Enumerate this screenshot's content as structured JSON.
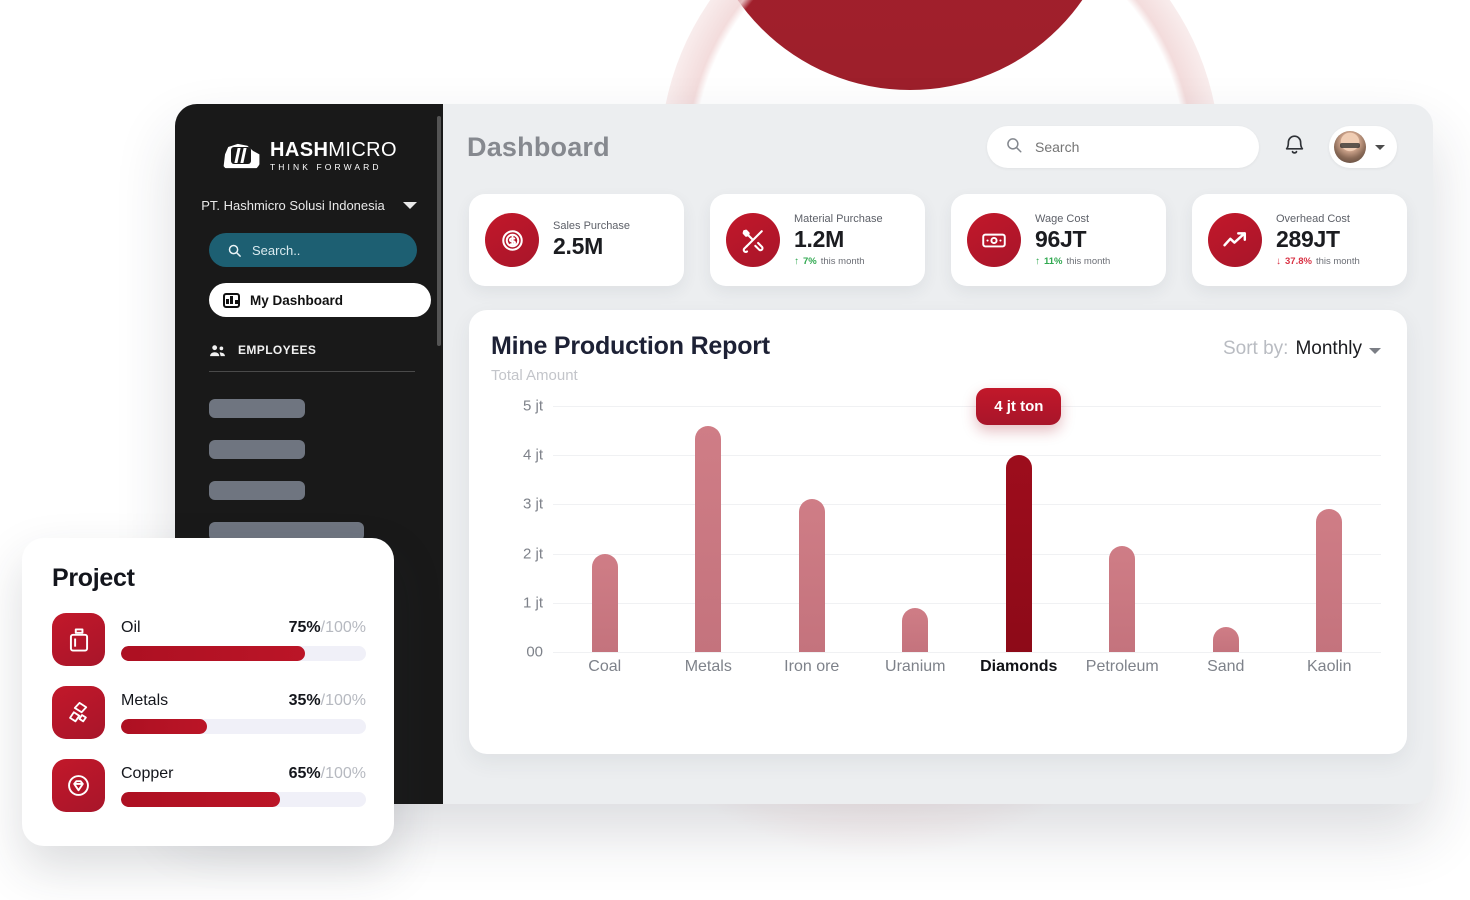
{
  "sidebar": {
    "logo": {
      "name_bold": "HASH",
      "name_light": "MICRO",
      "tagline": "THINK FORWARD"
    },
    "company": "PT. Hashmicro Solusi Indonesia",
    "search_placeholder": "Search..",
    "active_item": "My Dashboard",
    "section_label": "EMPLOYEES"
  },
  "topbar": {
    "page_title": "Dashboard",
    "search_placeholder": "Search",
    "search_value": ""
  },
  "kpis": [
    {
      "label": "Sales Purchase",
      "value": "2.5M",
      "icon": "dollar-circle-icon",
      "delta": "",
      "delta_suffix": "",
      "direction": "none"
    },
    {
      "label": "Material Purchase",
      "value": "1.2M",
      "icon": "tools-icon",
      "delta": "7%",
      "delta_suffix": "this month",
      "direction": "up"
    },
    {
      "label": "Wage Cost",
      "value": "96JT",
      "icon": "banknote-icon",
      "delta": "11%",
      "delta_suffix": "this month",
      "direction": "up"
    },
    {
      "label": "Overhead Cost",
      "value": "289JT",
      "icon": "trend-up-icon",
      "delta": "37.8%",
      "delta_suffix": "this month",
      "direction": "down"
    }
  ],
  "chart_panel": {
    "title": "Mine Production Report",
    "subtitle": "Total Amount",
    "sort_label": "Sort by:",
    "sort_value": "Monthly",
    "tooltip": "4 jt ton"
  },
  "chart_data": {
    "type": "bar",
    "title": "Mine Production Report",
    "subtitle": "Total Amount",
    "xlabel": "",
    "ylabel": "",
    "categories": [
      "Coal",
      "Metals",
      "Iron ore",
      "Uranium",
      "Diamonds",
      "Petroleum",
      "Sand",
      "Kaolin"
    ],
    "values": [
      2.0,
      4.6,
      3.1,
      0.9,
      4.0,
      2.15,
      0.5,
      2.9
    ],
    "unit": "jt",
    "ytick_labels": [
      "5 jt",
      "4 jt",
      "3 jt",
      "2 jt",
      "1 jt",
      "00"
    ],
    "ytick_values": [
      5,
      4,
      3,
      2,
      1,
      0
    ],
    "ylim": [
      0,
      5
    ],
    "grid": true,
    "legend": "none",
    "highlight_index": 4,
    "highlight_label": "4 jt ton",
    "bar_color": "#c4737d",
    "highlight_color": "#9d0d1c"
  },
  "project_card": {
    "title": "Project",
    "items": [
      {
        "name": "Oil",
        "percent": "75%",
        "denominator": "/100%",
        "value": 75,
        "icon": "oil-can-icon"
      },
      {
        "name": "Metals",
        "percent": "35%",
        "denominator": "/100%",
        "value": 35,
        "icon": "metal-bars-icon"
      },
      {
        "name": "Copper",
        "percent": "65%",
        "denominator": "/100%",
        "value": 65,
        "icon": "gem-circle-icon"
      }
    ]
  },
  "colors": {
    "brand_red": "#b51528",
    "dark_red": "#9d0d1c",
    "sidebar_bg": "#191919",
    "accent_teal": "#1d5f72"
  }
}
